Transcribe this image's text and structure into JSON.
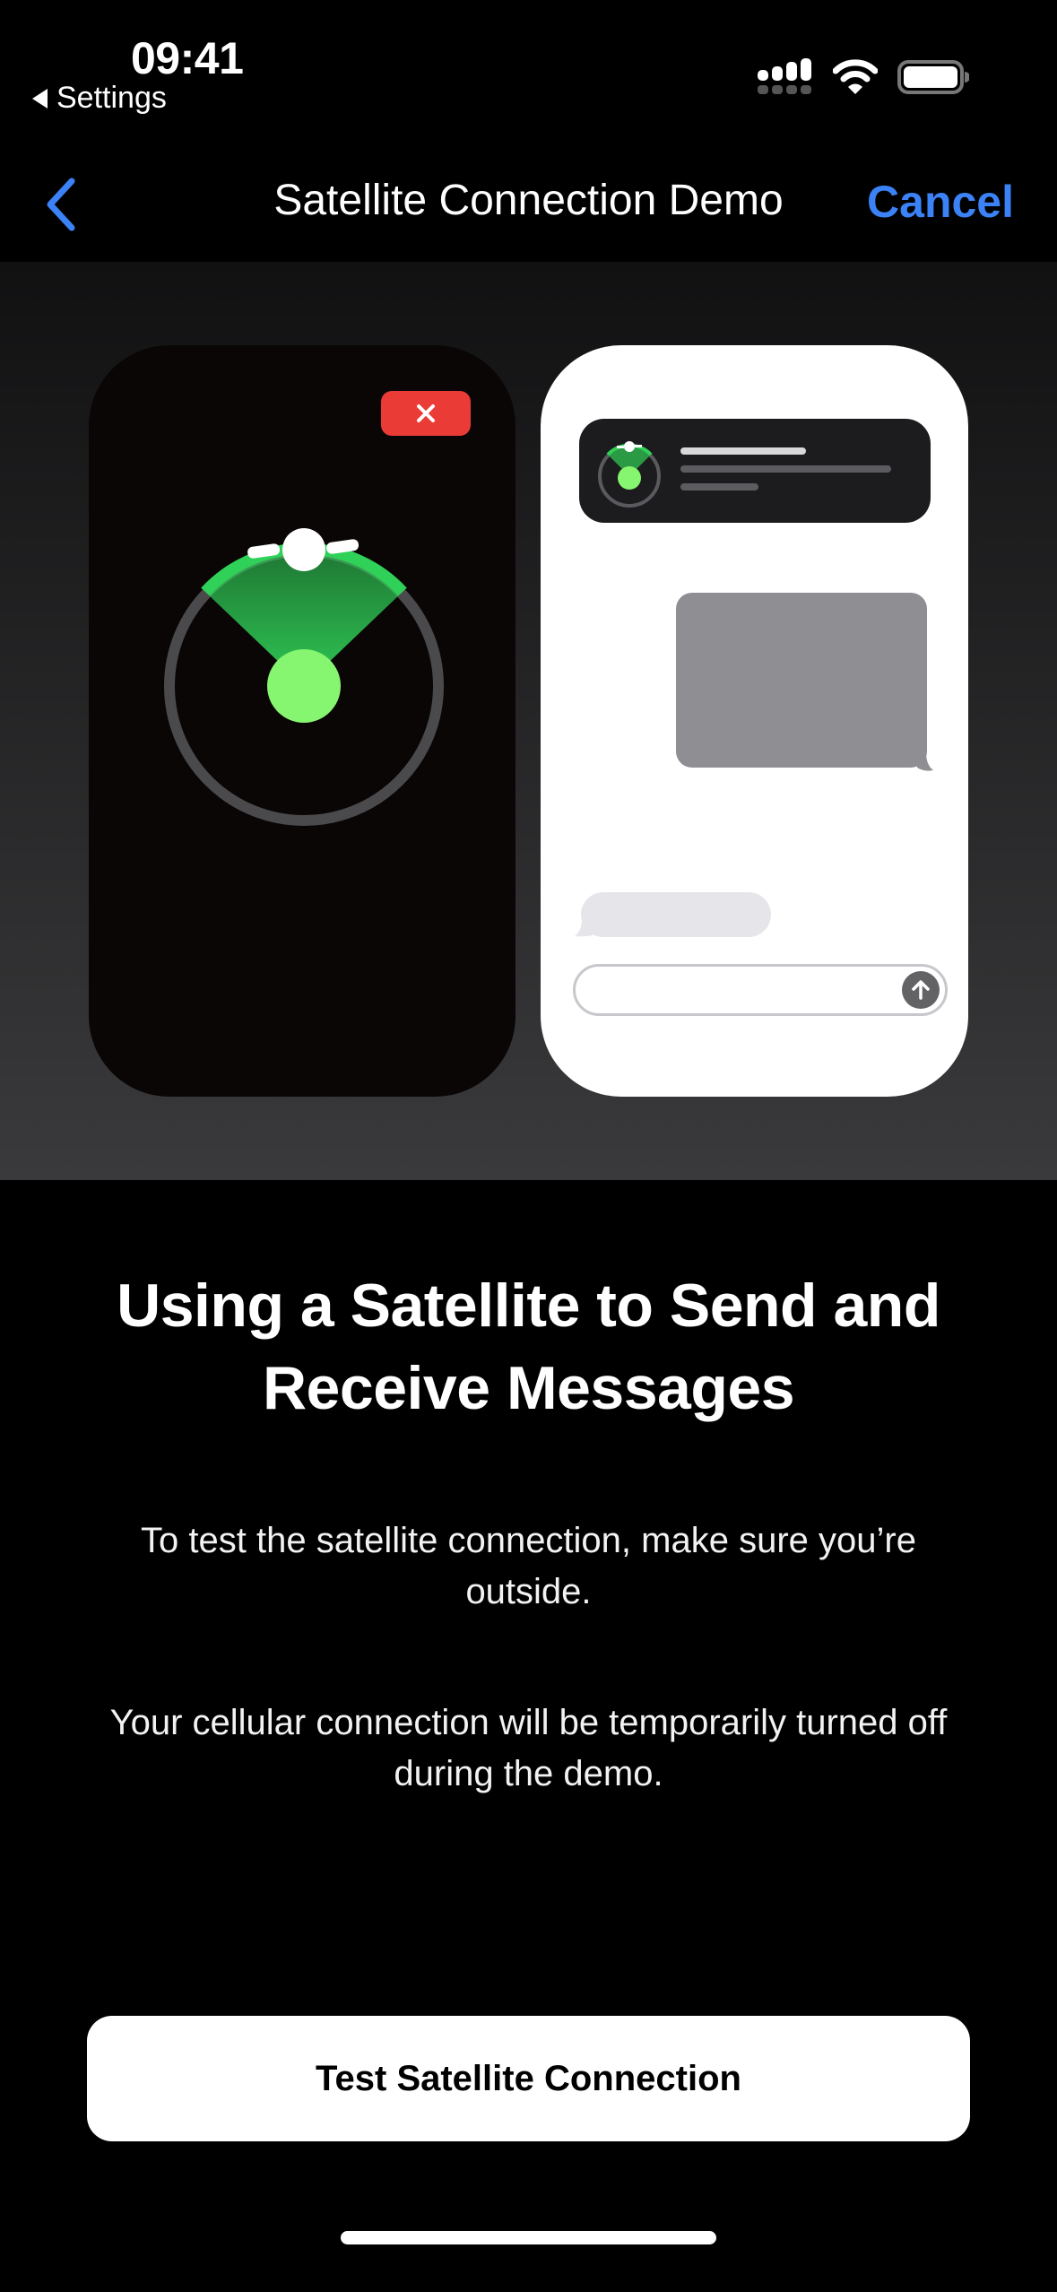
{
  "status_bar": {
    "time": "09:41",
    "back_app_label": "Settings",
    "icons": [
      "cellular-signal-icon",
      "wifi-icon",
      "battery-icon"
    ]
  },
  "nav": {
    "back_icon": "chevron-left-icon",
    "title": "Satellite Connection Demo",
    "cancel_label": "Cancel",
    "accent_color": "#3b82f6"
  },
  "illustration": {
    "left_phone": {
      "close_icon": "close-icon",
      "close_color": "#eb3b36",
      "radar_color": "#30d158",
      "target_color": "#86f56f"
    },
    "right_phone": {
      "notification_icon": "satellite-radar-icon",
      "send_icon": "arrow-up-icon"
    }
  },
  "content": {
    "headline": "Using a Satellite to Send and Receive Messages",
    "paragraph_1": "To test the satellite connection, make sure you’re outside.",
    "paragraph_2": "Your cellular connection will be temporarily turned off during the demo."
  },
  "actions": {
    "primary_label": "Test Satellite Connection"
  }
}
